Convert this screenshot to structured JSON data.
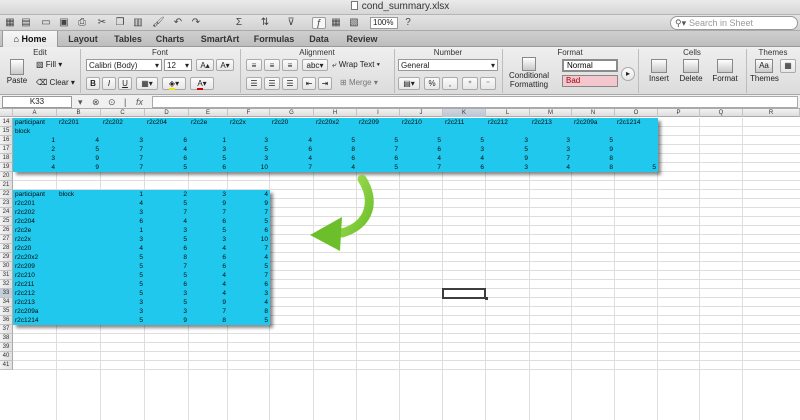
{
  "window": {
    "title": "cond_summary.xlsx"
  },
  "toolbar": {
    "zoom": "100%",
    "search_placeholder": "Search in Sheet"
  },
  "ribbon": {
    "tabs": [
      "Home",
      "Layout",
      "Tables",
      "Charts",
      "SmartArt",
      "Formulas",
      "Data",
      "Review"
    ],
    "groups": {
      "edit": "Edit",
      "font": "Font",
      "alignment": "Alignment",
      "number": "Number",
      "format": "Format",
      "cells": "Cells",
      "themes": "Themes"
    },
    "edit": {
      "paste": "Paste",
      "fill": "Fill",
      "clear": "Clear"
    },
    "font": {
      "name": "Calibri (Body)",
      "size": "12",
      "grow": "A",
      "shrink": "A",
      "bold": "B",
      "italic": "I",
      "underline": "U",
      "color": "A"
    },
    "alignment": {
      "abc": "abc",
      "wrap": "Wrap Text",
      "merge": "Merge"
    },
    "number": {
      "format": "General",
      "percent": "%",
      "comma": ","
    },
    "format": {
      "conditional": "Conditional",
      "formatting": "Formatting",
      "style_normal": "Normal",
      "style_bad": "Bad"
    },
    "cells": {
      "insert": "Insert",
      "delete": "Delete",
      "format": "Format"
    },
    "themes": {
      "themes": "Themes",
      "aa": "Aa"
    }
  },
  "formula_bar": {
    "name_box": "K33",
    "fx": "fx",
    "value": ""
  },
  "grid": {
    "columns": [
      "A",
      "B",
      "C",
      "D",
      "E",
      "F",
      "G",
      "H",
      "I",
      "J",
      "K",
      "L",
      "M",
      "N",
      "O",
      "P",
      "Q",
      "R"
    ],
    "selected_column": "K",
    "rows": [
      "14",
      "15",
      "16",
      "17",
      "18",
      "19",
      "20",
      "21",
      "22",
      "23",
      "24",
      "25",
      "26",
      "27",
      "28",
      "29",
      "30",
      "31",
      "32",
      "33",
      "34",
      "35",
      "36",
      "37",
      "38",
      "39",
      "40",
      "41"
    ],
    "selected_row": "33",
    "selected_cell": "K33"
  },
  "table1": {
    "header_label": "participant",
    "block_label": "block",
    "columns": [
      "r2c201",
      "r2c202",
      "r2c204",
      "r2c2e",
      "r2c2x",
      "r2c20",
      "r2c20x2",
      "r2c209",
      "r2c210",
      "r2c211",
      "r2c212",
      "r2c213",
      "r2c209a",
      "r2c1214"
    ],
    "rows": [
      {
        "participant": "1",
        "values": [
          "4",
          "3",
          "6",
          "1",
          "3",
          "4",
          "5",
          "5",
          "5",
          "5",
          "3",
          "3",
          "5"
        ]
      },
      {
        "participant": "2",
        "values": [
          "5",
          "7",
          "4",
          "3",
          "5",
          "6",
          "8",
          "7",
          "6",
          "3",
          "5",
          "3",
          "9"
        ]
      },
      {
        "participant": "3",
        "values": [
          "9",
          "7",
          "6",
          "5",
          "3",
          "4",
          "6",
          "6",
          "4",
          "4",
          "9",
          "7",
          "8"
        ]
      },
      {
        "participant": "4",
        "values": [
          "9",
          "7",
          "5",
          "6",
          "10",
          "7",
          "4",
          "5",
          "7",
          "6",
          "3",
          "4",
          "8",
          "5"
        ]
      }
    ]
  },
  "table2": {
    "headers": [
      "participant",
      "block",
      "1",
      "2",
      "3",
      "4"
    ],
    "rows": [
      {
        "name": "r2c201",
        "values": [
          "4",
          "5",
          "9",
          "9"
        ]
      },
      {
        "name": "r2c202",
        "values": [
          "3",
          "7",
          "7",
          "7"
        ]
      },
      {
        "name": "r2c204",
        "values": [
          "6",
          "4",
          "6",
          "5"
        ]
      },
      {
        "name": "r2c2e",
        "values": [
          "1",
          "3",
          "5",
          "6"
        ]
      },
      {
        "name": "r2c2x",
        "values": [
          "3",
          "5",
          "3",
          "10"
        ]
      },
      {
        "name": "r2c20",
        "values": [
          "4",
          "6",
          "4",
          "7"
        ]
      },
      {
        "name": "r2c20x2",
        "values": [
          "5",
          "8",
          "6",
          "4"
        ]
      },
      {
        "name": "r2c209",
        "values": [
          "5",
          "7",
          "6",
          "5"
        ]
      },
      {
        "name": "r2c210",
        "values": [
          "5",
          "5",
          "4",
          "7"
        ]
      },
      {
        "name": "r2c211",
        "values": [
          "5",
          "6",
          "4",
          "6"
        ]
      },
      {
        "name": "r2c212",
        "values": [
          "5",
          "3",
          "4",
          "3"
        ]
      },
      {
        "name": "r2c213",
        "values": [
          "3",
          "5",
          "9",
          "4"
        ]
      },
      {
        "name": "r2c209a",
        "values": [
          "3",
          "3",
          "7",
          "8"
        ]
      },
      {
        "name": "r2c1214",
        "values": [
          "5",
          "9",
          "8",
          "5"
        ]
      }
    ]
  },
  "colors": {
    "highlight": "#1fc8ec",
    "arrow": "#6cbf2a"
  }
}
